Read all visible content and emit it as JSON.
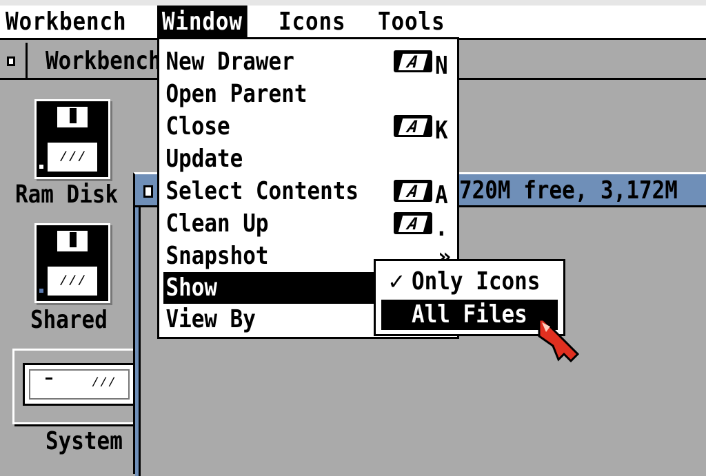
{
  "menubar": {
    "menus": [
      {
        "label": "Workbench",
        "active": false
      },
      {
        "label": "Window",
        "active": true
      },
      {
        "label": "Icons",
        "active": false
      },
      {
        "label": "Tools",
        "active": false
      }
    ]
  },
  "workbench_window": {
    "title": "Workbench"
  },
  "desktop_icons": [
    {
      "label": "Ram Disk",
      "icon": "floppy-disk-icon"
    },
    {
      "label": "Shared",
      "icon": "floppy-disk-icon"
    },
    {
      "label": "System",
      "icon": "hard-drive-icon"
    }
  ],
  "drawer_window": {
    "title": "720M free, 3,172M"
  },
  "window_menu": {
    "items": [
      {
        "label": "New Drawer",
        "shortcut_key": "N"
      },
      {
        "label": "Open Parent",
        "shortcut_key": ""
      },
      {
        "label": "Close",
        "shortcut_key": "K"
      },
      {
        "label": "Update",
        "shortcut_key": ""
      },
      {
        "label": "Select Contents",
        "shortcut_key": "A"
      },
      {
        "label": "Clean Up",
        "shortcut_key": "."
      },
      {
        "label": "Snapshot",
        "submenu_indicator": "»"
      },
      {
        "label": "Show",
        "highlighted": true
      },
      {
        "label": "View By"
      }
    ]
  },
  "show_submenu": {
    "items": [
      {
        "label": "Only Icons",
        "checked": true,
        "check_mark": "✓"
      },
      {
        "label": "All Files",
        "highlighted": true
      }
    ]
  },
  "colors": {
    "desktop": "#aaaaaa",
    "titlebar_active": "#6f8fb8",
    "pointer": "#e03020"
  }
}
